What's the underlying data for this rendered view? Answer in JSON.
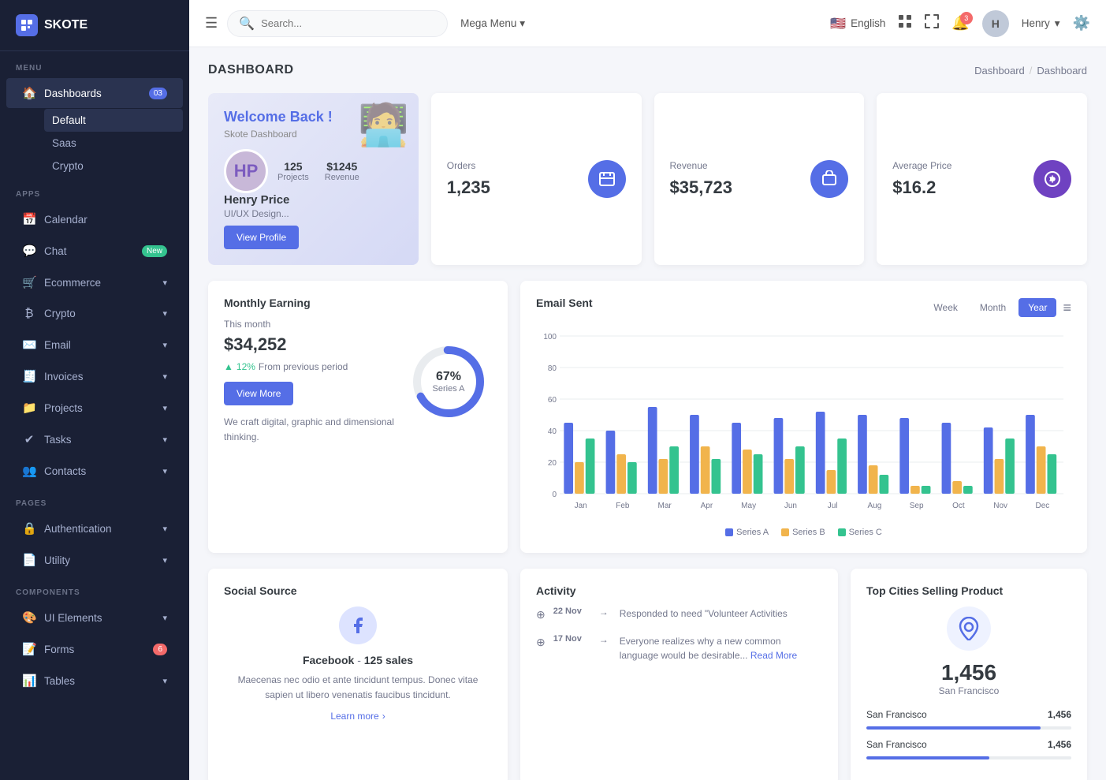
{
  "app": {
    "name": "SKOTE"
  },
  "sidebar": {
    "menu_label": "MENU",
    "apps_label": "APPS",
    "pages_label": "PAGES",
    "components_label": "COMPONENTS",
    "items_menu": [
      {
        "id": "dashboards",
        "label": "Dashboards",
        "icon": "🏠",
        "badge": "03",
        "badgeColor": "blue",
        "active": true
      },
      {
        "id": "default",
        "label": "Default",
        "sub": true,
        "active": true
      },
      {
        "id": "saas",
        "label": "Saas",
        "sub": true
      },
      {
        "id": "crypto",
        "label": "Crypto",
        "sub": true
      }
    ],
    "items_apps": [
      {
        "id": "calendar",
        "label": "Calendar",
        "icon": "📅"
      },
      {
        "id": "chat",
        "label": "Chat",
        "icon": "💬",
        "badge": "New",
        "badgeColor": "green"
      },
      {
        "id": "ecommerce",
        "label": "Ecommerce",
        "icon": "🛒",
        "chevron": true
      },
      {
        "id": "crypto",
        "label": "Crypto",
        "icon": "₿",
        "chevron": true
      },
      {
        "id": "email",
        "label": "Email",
        "icon": "✉️",
        "chevron": true
      },
      {
        "id": "invoices",
        "label": "Invoices",
        "icon": "🧾",
        "chevron": true
      },
      {
        "id": "projects",
        "label": "Projects",
        "icon": "📁",
        "chevron": true
      },
      {
        "id": "tasks",
        "label": "Tasks",
        "icon": "✓",
        "chevron": true
      },
      {
        "id": "contacts",
        "label": "Contacts",
        "icon": "👥",
        "chevron": true
      }
    ],
    "items_pages": [
      {
        "id": "authentication",
        "label": "Authentication",
        "icon": "🔒",
        "chevron": true
      },
      {
        "id": "utility",
        "label": "Utility",
        "icon": "📄",
        "chevron": true
      }
    ],
    "items_components": [
      {
        "id": "ui-elements",
        "label": "UI Elements",
        "icon": "🎨",
        "chevron": true
      },
      {
        "id": "forms",
        "label": "Forms",
        "icon": "📝",
        "badge": "6",
        "badgeColor": "red"
      },
      {
        "id": "tables",
        "label": "Tables",
        "icon": "📊",
        "chevron": true
      }
    ]
  },
  "topbar": {
    "search_placeholder": "Search...",
    "mega_menu": "Mega Menu",
    "language": "English",
    "notifications_count": "3",
    "user_name": "Henry"
  },
  "page": {
    "title": "DASHBOARD",
    "breadcrumb": [
      "Dashboard",
      "Dashboard"
    ]
  },
  "welcome": {
    "title": "Welcome Back !",
    "subtitle": "Skote Dashboard",
    "projects_count": "125",
    "projects_label": "Projects",
    "revenue": "$1245",
    "revenue_label": "Revenue",
    "name": "Henry Price",
    "role": "UI/UX Design...",
    "view_profile": "View Profile"
  },
  "stats": [
    {
      "id": "orders",
      "label": "Orders",
      "value": "1,235",
      "icon": "📦",
      "color": "blue"
    },
    {
      "id": "revenue",
      "label": "Revenue",
      "value": "$35,723",
      "icon": "💼",
      "color": "blue"
    },
    {
      "id": "avg-price",
      "label": "Average Price",
      "value": "$16.2",
      "icon": "🏷️",
      "color": "indigo"
    }
  ],
  "monthly": {
    "title": "Monthly Earning",
    "this_month": "This month",
    "amount": "$34,252",
    "change_pct": "12%",
    "change_label": "From previous period",
    "donut_pct": "67%",
    "donut_series": "Series A",
    "view_more": "View More",
    "desc": "We craft digital, graphic and dimensional thinking."
  },
  "email_chart": {
    "title": "Email Sent",
    "tabs": [
      "Week",
      "Month",
      "Year"
    ],
    "active_tab": "Year",
    "x_labels": [
      "Jan",
      "Feb",
      "Mar",
      "Apr",
      "May",
      "Jun",
      "Jul",
      "Aug",
      "Sep",
      "Oct",
      "Nov",
      "Dec"
    ],
    "y_labels": [
      "0",
      "20",
      "40",
      "60",
      "80",
      "100"
    ],
    "series_a_label": "Series A",
    "series_b_label": "Series B",
    "series_c_label": "Series C",
    "data": [
      {
        "a": 45,
        "b": 20,
        "c": 35
      },
      {
        "a": 40,
        "b": 25,
        "c": 20
      },
      {
        "a": 55,
        "b": 22,
        "c": 30
      },
      {
        "a": 50,
        "b": 30,
        "c": 22
      },
      {
        "a": 45,
        "b": 28,
        "c": 25
      },
      {
        "a": 48,
        "b": 22,
        "c": 30
      },
      {
        "a": 52,
        "b": 15,
        "c": 35
      },
      {
        "a": 50,
        "b": 18,
        "c": 12
      },
      {
        "a": 48,
        "b": 5,
        "c": 5
      },
      {
        "a": 45,
        "b": 8,
        "c": 5
      },
      {
        "a": 42,
        "b": 22,
        "c": 35
      },
      {
        "a": 50,
        "b": 30,
        "c": 25
      }
    ]
  },
  "social_source": {
    "title": "Social Source",
    "platform": "Facebook",
    "sales": "125 sales",
    "desc": "Maecenas nec odio et ante tincidunt tempus. Donec vitae sapien ut libero venenatis faucibus tincidunt.",
    "learn_more": "Learn more"
  },
  "activity": {
    "title": "Activity",
    "items": [
      {
        "date": "22 Nov",
        "text": "Responded to need \"Volunteer Activities"
      },
      {
        "date": "17 Nov",
        "text": "Everyone realizes why a new common language would be desirable...",
        "link": "Read More"
      }
    ]
  },
  "top_cities": {
    "title": "Top Cities Selling Product",
    "count": "1,456",
    "city": "San Francisco",
    "rows": [
      {
        "name": "San Francisco",
        "value": "1,456",
        "pct": 85
      },
      {
        "name": "San Francisco",
        "value": "1,456",
        "pct": 60
      }
    ]
  }
}
